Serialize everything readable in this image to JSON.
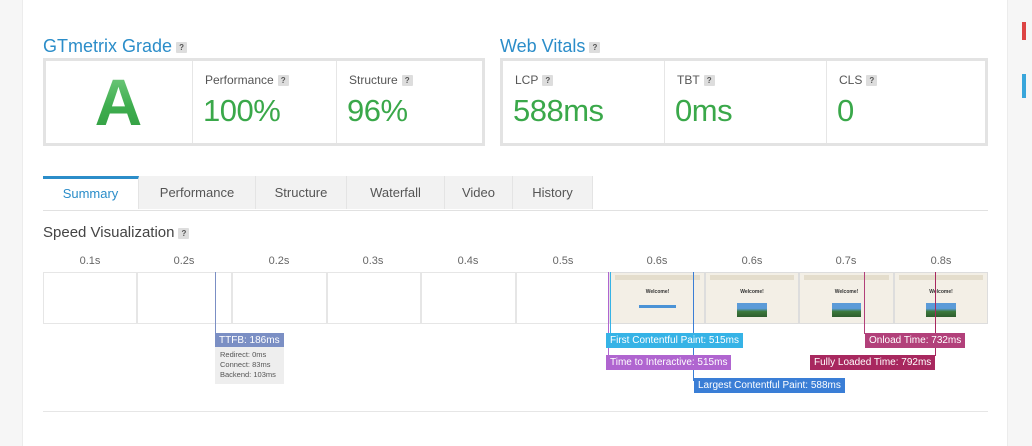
{
  "grade_section": {
    "title": "GTmetrix Grade",
    "grade": "A",
    "performance": {
      "label": "Performance",
      "value": "100%"
    },
    "structure": {
      "label": "Structure",
      "value": "96%"
    }
  },
  "vitals_section": {
    "title": "Web Vitals",
    "lcp": {
      "label": "LCP",
      "value": "588ms"
    },
    "tbt": {
      "label": "TBT",
      "value": "0ms"
    },
    "cls": {
      "label": "CLS",
      "value": "0"
    }
  },
  "help_glyph": "?",
  "tabs": [
    {
      "label": "Summary",
      "active": true
    },
    {
      "label": "Performance",
      "active": false
    },
    {
      "label": "Structure",
      "active": false
    },
    {
      "label": "Waterfall",
      "active": false
    },
    {
      "label": "Video",
      "active": false
    },
    {
      "label": "History",
      "active": false
    }
  ],
  "speed_visualization": {
    "title": "Speed Visualization",
    "ticks": [
      "0.1s",
      "0.2s",
      "0.2s",
      "0.3s",
      "0.4s",
      "0.5s",
      "0.6s",
      "0.6s",
      "0.7s",
      "0.8s"
    ],
    "frame_title": "Welcome!",
    "ttfb": {
      "label": "TTFB: 186ms",
      "redirect": "Redirect: 0ms",
      "connect": "Connect: 83ms",
      "backend": "Backend: 103ms",
      "color": "#7b8fc4"
    },
    "markers": {
      "fcp": {
        "label": "First Contentful Paint: 515ms",
        "color": "#36b3e6"
      },
      "tti": {
        "label": "Time to Interactive: 515ms",
        "color": "#b065d0"
      },
      "lcp": {
        "label": "Largest Contentful Paint: 588ms",
        "color": "#3a7ed6"
      },
      "onload": {
        "label": "Onload Time: 732ms",
        "color": "#b2407a"
      },
      "fully_loaded": {
        "label": "Fully Loaded Time: 792ms",
        "color": "#a8285f"
      }
    }
  },
  "colors": {
    "accent": "#2b8dc9",
    "good": "#3aa84a"
  }
}
